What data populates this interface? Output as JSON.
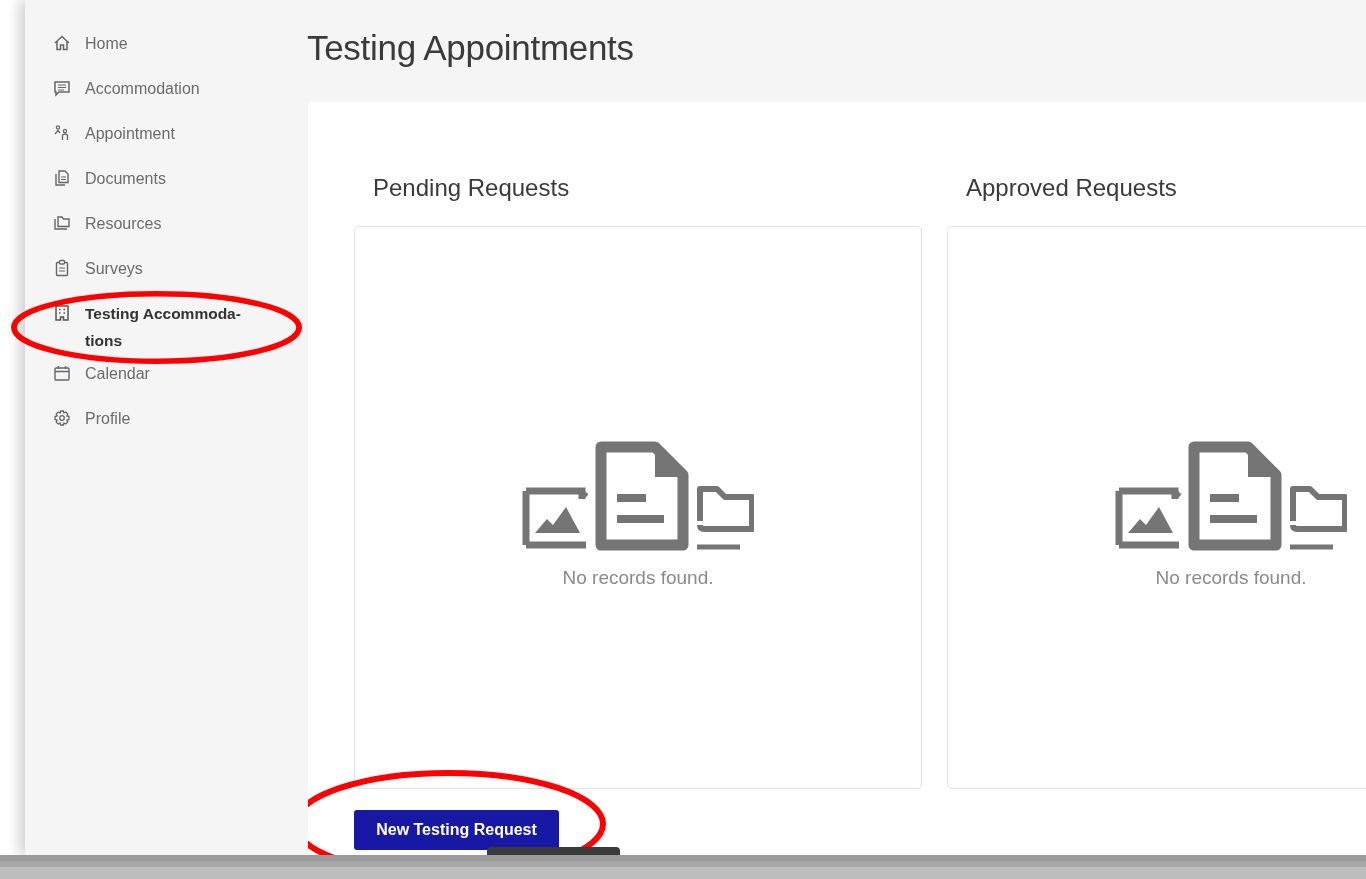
{
  "sidebar": {
    "items": [
      {
        "label": "Home",
        "selected": false,
        "circled": false
      },
      {
        "label": "Accommodation",
        "selected": false,
        "circled": false
      },
      {
        "label": "Appointment",
        "selected": false,
        "circled": false
      },
      {
        "label": "Documents",
        "selected": false,
        "circled": false
      },
      {
        "label": "Resources",
        "selected": false,
        "circled": false
      },
      {
        "label": "Surveys",
        "selected": false,
        "circled": false
      },
      {
        "label": "Testing Accommoda-tions",
        "selected": true,
        "circled": true
      },
      {
        "label": "Calendar",
        "selected": false,
        "circled": false
      },
      {
        "label": "Profile",
        "selected": false,
        "circled": false
      }
    ]
  },
  "page_title": "Testing Appointments",
  "panels": [
    {
      "title": "Pending Requests",
      "empty_text": "No records found."
    },
    {
      "title": "Approved Requests",
      "empty_text": "No records found."
    }
  ],
  "new_request_button": {
    "label": "New Testing Request",
    "circled": true
  }
}
